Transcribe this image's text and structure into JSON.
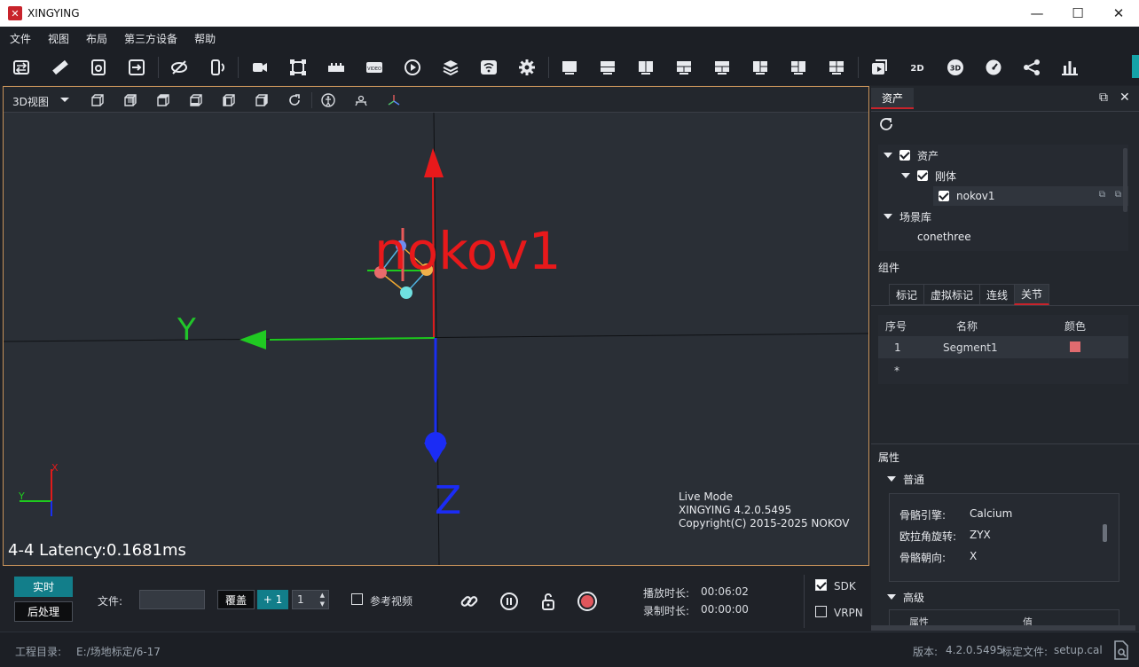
{
  "window": {
    "title": "XINGYING"
  },
  "menu": [
    "文件",
    "视图",
    "布局",
    "第三方设备",
    "帮助"
  ],
  "viewport": {
    "view_label": "3D视图",
    "object_label": "nokov1",
    "axis_y": "Y",
    "axis_z": "Z",
    "gizmo_x": "X",
    "gizmo_y": "Y",
    "info_mode": "Live Mode",
    "info_version": "XINGYING 4.2.0.5495",
    "info_copyright": "Copyright(C) 2015-2025 NOKOV",
    "latency": "4-4 Latency:0.1681ms"
  },
  "panel": {
    "tab": "资产",
    "tree": {
      "assets": "资产",
      "rigid": "刚体",
      "rigid_item": "nokov1",
      "scene": "场景库",
      "scene_item": "conethree"
    },
    "components_title": "组件",
    "component_tabs": [
      "标记",
      "虚拟标记",
      "连线",
      "关节"
    ],
    "table": {
      "headers": [
        "序号",
        "名称",
        "颜色"
      ],
      "row_index": "1",
      "row_name": "Segment1",
      "row_color": "#e06b6f",
      "new_row": "*"
    },
    "properties_title": "属性",
    "general_title": "普通",
    "props": [
      {
        "k": "骨骼引擎:",
        "v": "Calcium"
      },
      {
        "k": "欧拉角旋转:",
        "v": "ZYX"
      },
      {
        "k": "骨骼朝向:",
        "v": "X"
      }
    ],
    "advanced_title": "高级",
    "adv_headers": [
      "属性",
      "值"
    ]
  },
  "bottom": {
    "realtime": "实时",
    "postprocess": "后处理",
    "file_label": "文件:",
    "overwrite": "覆盖",
    "plus_one": "+ 1",
    "counter": "1",
    "reference_video": "参考视频",
    "play_label": "播放时长:",
    "play_time": "00:06:02",
    "record_label": "录制时长:",
    "record_time": "00:00:00",
    "sdk": "SDK",
    "vrpn": "VRPN"
  },
  "status": {
    "project_label": "工程目录:",
    "project_path": "E:/场地标定/6-17",
    "version_label": "版本:",
    "version": "4.2.0.5495",
    "calib_label": "标定文件:",
    "calib_file": "setup.cal"
  },
  "colors": {
    "accent": "#15a3a8",
    "brand_red": "#c8232b",
    "viewport_border": "#c7925a"
  }
}
